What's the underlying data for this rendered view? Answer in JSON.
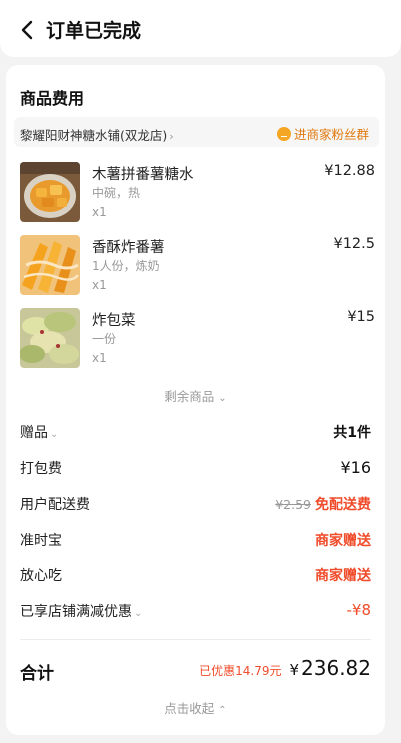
{
  "header": {
    "title": "订单已完成",
    "back_icon": "back-arrow-icon"
  },
  "section": {
    "title": "商品费用"
  },
  "shop": {
    "name": "黎耀阳财神糖水铺(双龙店)",
    "chevron": "›",
    "fan_group_label": "进商家粉丝群",
    "fan_icon": "fan-group-icon"
  },
  "items": [
    {
      "name": "木薯拼番薯糖水",
      "spec": "中碗，热",
      "qty": "x1",
      "price": "¥12.88"
    },
    {
      "name": "香酥炸番薯",
      "spec": "1人份，炼奶",
      "qty": "x1",
      "price": "¥12.5"
    },
    {
      "name": "炸包菜",
      "spec": "一份",
      "qty": "x1",
      "price": "¥15"
    }
  ],
  "more_items": {
    "label": "剩余商品",
    "chevron": "⌄"
  },
  "fees": [
    {
      "label": "赠品",
      "value": "共1件"
    },
    {
      "label": "打包费",
      "value": "¥16"
    },
    {
      "label": "用户配送费",
      "original": "¥2.59",
      "value": "免配送费"
    },
    {
      "label": "准时宝",
      "value": "商家赠送"
    },
    {
      "label": "放心吃",
      "value": "商家赠送"
    },
    {
      "label": "已享店铺满减优惠",
      "value": "-¥8"
    }
  ],
  "total": {
    "label": "合计",
    "saved": "已优惠14.79元",
    "currency": "¥",
    "amount": "236.82"
  },
  "collapse": {
    "label": "点击收起",
    "chevron": "⌃"
  },
  "colors": {
    "accent_red": "#f04b2a",
    "fan_orange": "#f5a623"
  }
}
